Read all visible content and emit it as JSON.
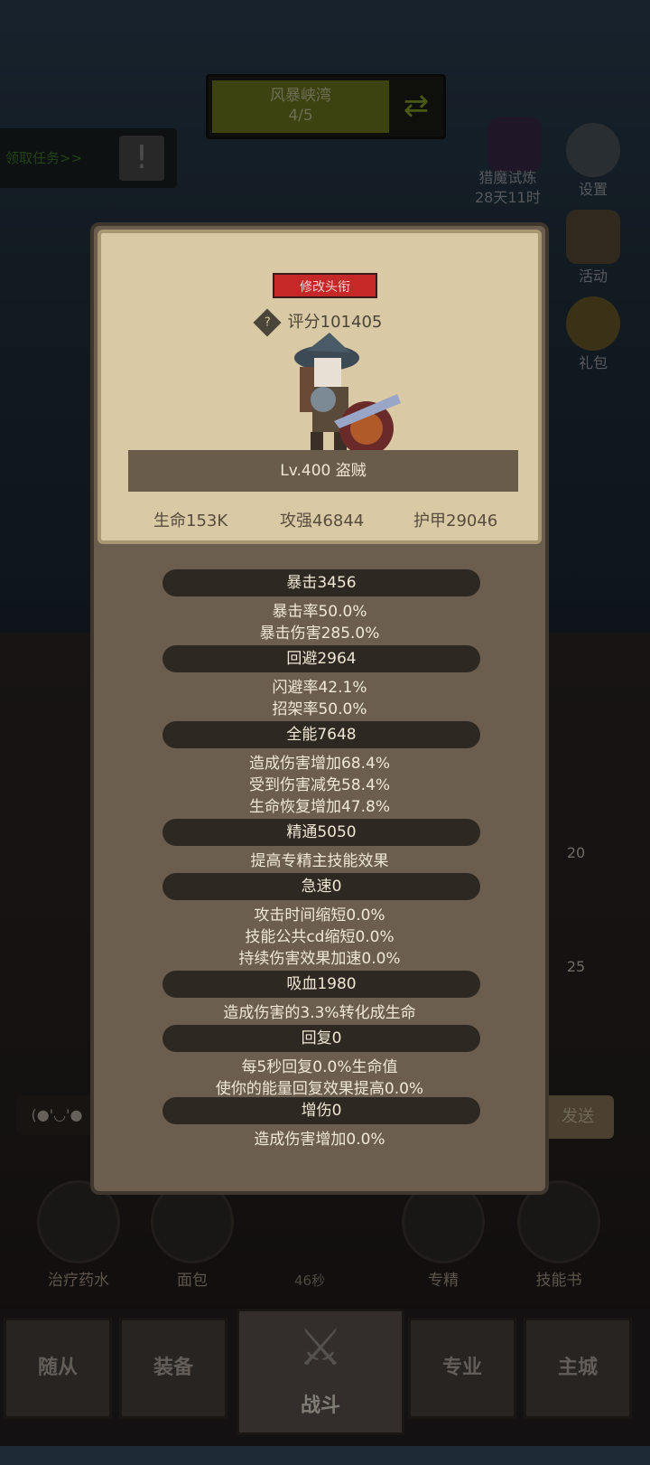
{
  "hud": {
    "stage_name": "风暴峡湾",
    "stage_progress": "4/5",
    "quest_link": "领取任务>>",
    "trial_name": "猎魔试炼",
    "trial_time": "28天11时",
    "settings": "设置",
    "activity": "活动",
    "gift": "礼包"
  },
  "profile": {
    "title_button": "修改头衔",
    "score": "评分101405",
    "level_class": "Lv.400 盗贼",
    "hp": "生命153K",
    "attack": "攻强46844",
    "armor": "护甲29046"
  },
  "sections": [
    {
      "header": "暴击3456",
      "lines": [
        "暴击率50.0%",
        "暴击伤害285.0%"
      ]
    },
    {
      "header": "回避2964",
      "lines": [
        "闪避率42.1%",
        "招架率50.0%"
      ]
    },
    {
      "header": "全能7648",
      "lines": [
        "造成伤害增加68.4%",
        "受到伤害减免58.4%",
        "生命恢复增加47.8%"
      ]
    },
    {
      "header": "精通5050",
      "lines": [
        "提高专精主技能效果"
      ]
    },
    {
      "header": "急速0",
      "lines": [
        "攻击时间缩短0.0%",
        "技能公共cd缩短0.0%",
        "持续伤害效果加速0.0%"
      ]
    },
    {
      "header": "吸血1980",
      "lines": [
        "造成伤害的3.3%转化成生命"
      ]
    },
    {
      "header": "回复0",
      "lines": [
        "每5秒回复0.0%生命值",
        "使你的能量回复效果提高0.0%"
      ]
    },
    {
      "header": "增伤0",
      "lines": [
        "造成伤害增加0.0%"
      ]
    }
  ],
  "bottom": {
    "chat_emote": "(●'◡'●",
    "send": "发送",
    "skills": [
      "治疗药水",
      "面包",
      "专精",
      "技能书"
    ],
    "timer": "46秒",
    "badge1": "20",
    "badge2": "25"
  },
  "tabs": [
    "随从",
    "装备",
    "战斗",
    "专业",
    "主城"
  ],
  "colors": {
    "title_button": "#c62828",
    "stage_bar": "#6e7a1f",
    "modal_panel": "#6b5e4e"
  }
}
